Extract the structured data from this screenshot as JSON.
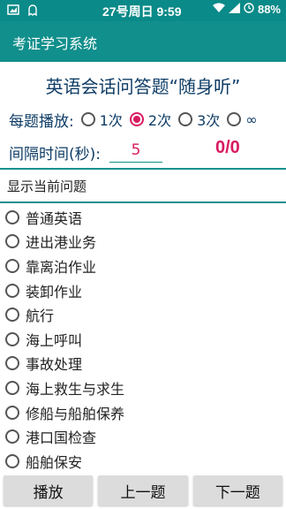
{
  "status_bar": {
    "time": "27号周日 9:59",
    "battery": "88%"
  },
  "app": {
    "title": "考证学习系统"
  },
  "heading": "英语会话问答题“随身听”",
  "play_count": {
    "label": "每题播放:",
    "options": [
      {
        "label": "1次",
        "selected": false
      },
      {
        "label": "2次",
        "selected": true
      },
      {
        "label": "3次",
        "selected": false
      },
      {
        "label": "∞",
        "selected": false
      }
    ]
  },
  "interval": {
    "label": "间隔时间(秒):",
    "value": "5",
    "counter": "0/0"
  },
  "question_display": "显示当前问题",
  "categories": [
    "普通英语",
    "进出港业务",
    "靠离泊作业",
    "装卸作业",
    "航行",
    "海上呼叫",
    "事故处理",
    "海上救生与求生",
    "修船与船舶保养",
    "港口国检查",
    "船舶保安"
  ],
  "buttons": {
    "play": "播放",
    "prev": "上一题",
    "next": "下一题"
  },
  "colors": {
    "primary": "#118f8c",
    "accent": "#d81b60",
    "text_dark_blue": "#0f3d66"
  }
}
